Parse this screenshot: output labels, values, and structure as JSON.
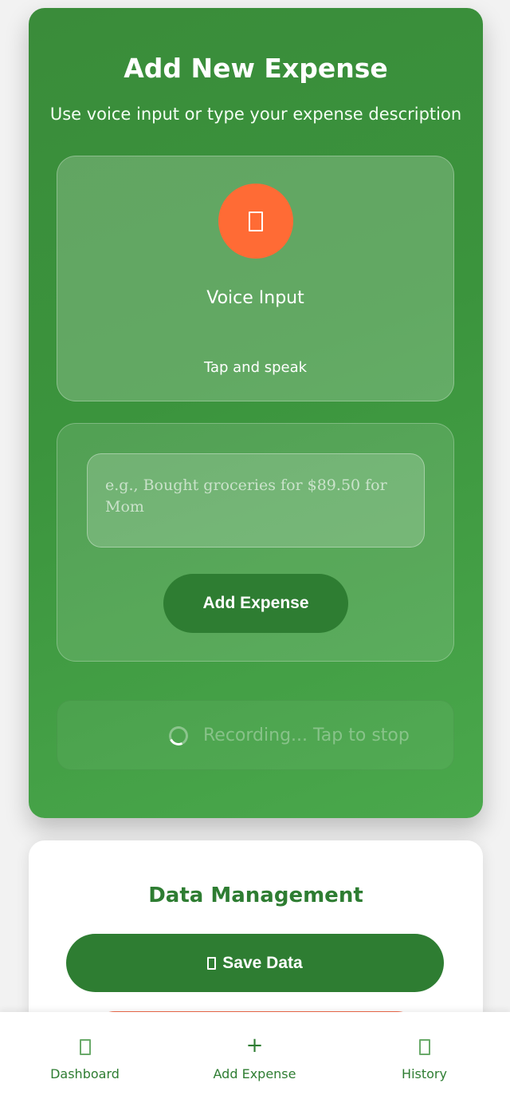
{
  "add_expense": {
    "title": "Add New Expense",
    "subtitle": "Use voice input or type your expense description",
    "voice": {
      "icon": "microphone-icon",
      "title": "Voice Input",
      "hint": "Tap and speak"
    },
    "text_input": {
      "placeholder": "e.g., Bought groceries for $89.50 for Mom",
      "value": ""
    },
    "submit_label": "Add Expense",
    "status": "Recording... Tap to stop"
  },
  "data_management": {
    "title": "Data Management",
    "save_label": "Save Data",
    "save_icon": "save-icon"
  },
  "bottom_nav": {
    "items": [
      {
        "label": "Dashboard",
        "icon": "dashboard-icon"
      },
      {
        "label": "Add Expense",
        "icon": "plus-icon",
        "active": true
      },
      {
        "label": "History",
        "icon": "history-icon"
      }
    ]
  },
  "colors": {
    "primary_green": "#2e7d32",
    "card_green": "#3b943d",
    "mic_orange": "#ff6b35",
    "surface": "#ffffff"
  }
}
